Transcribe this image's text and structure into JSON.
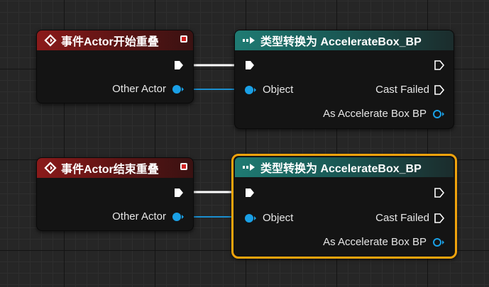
{
  "nodes": [
    {
      "event": {
        "title": "事件Actor开始重叠",
        "output_pin": "Other Actor"
      },
      "cast": {
        "title": "类型转换为 AccelerateBox_BP",
        "object_pin": "Object",
        "cast_failed_pin": "Cast Failed",
        "as_pin": "As Accelerate Box BP"
      }
    },
    {
      "event": {
        "title": "事件Actor结束重叠",
        "output_pin": "Other Actor"
      },
      "cast": {
        "title": "类型转换为 AccelerateBox_BP",
        "object_pin": "Object",
        "cast_failed_pin": "Cast Failed",
        "as_pin": "As Accelerate Box BP"
      }
    }
  ],
  "colors": {
    "event_header": "#8b1a1a",
    "cast_header": "#1f7b73",
    "object_pin": "#1aa0e6",
    "selection": "#f0a30c",
    "exec_wire": "#ffffff"
  },
  "icons": {
    "event": "event-diamond-icon",
    "cast": "cast-arrow-icon",
    "exec_pin": "exec-pin-icon",
    "object_pin": "object-pin-icon"
  }
}
